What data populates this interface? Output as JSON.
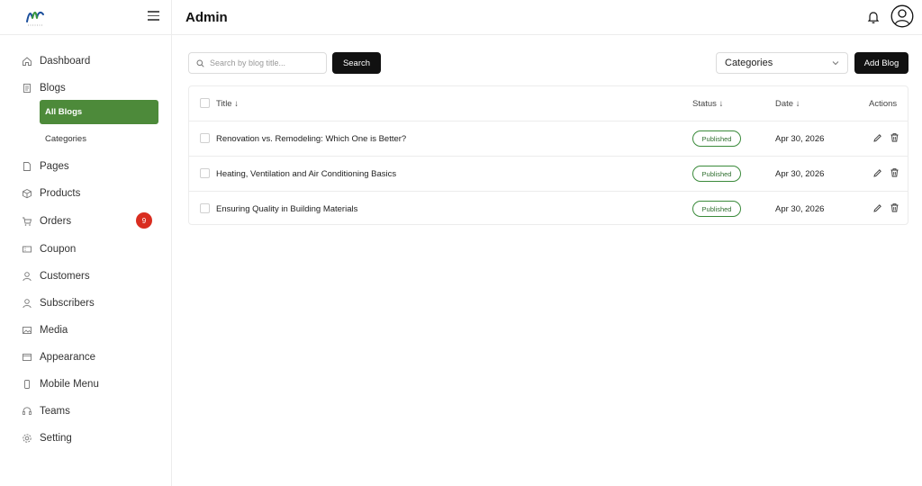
{
  "header": {
    "title": "Admin"
  },
  "sidebar": {
    "items": [
      {
        "label": "Dashboard",
        "icon": "home-icon"
      },
      {
        "label": "Blogs",
        "icon": "document-icon",
        "children": [
          {
            "label": "All Blogs",
            "active": true
          },
          {
            "label": "Categories"
          }
        ]
      },
      {
        "label": "Pages",
        "icon": "page-icon"
      },
      {
        "label": "Products",
        "icon": "box-icon"
      },
      {
        "label": "Orders",
        "icon": "cart-icon",
        "badge": "9"
      },
      {
        "label": "Coupon",
        "icon": "coupon-icon"
      },
      {
        "label": "Customers",
        "icon": "user-icon"
      },
      {
        "label": "Subscribers",
        "icon": "user-icon"
      },
      {
        "label": "Media",
        "icon": "media-icon"
      },
      {
        "label": "Appearance",
        "icon": "appearance-icon"
      },
      {
        "label": "Mobile Menu",
        "icon": "mobile-icon"
      },
      {
        "label": "Teams",
        "icon": "headset-icon"
      },
      {
        "label": "Setting",
        "icon": "gear-icon"
      }
    ]
  },
  "toolbar": {
    "search_placeholder": "Search by blog title...",
    "search_label": "Search",
    "category_select": "Categories",
    "add_label": "Add Blog"
  },
  "table": {
    "columns": {
      "title": "Title ↓",
      "status": "Status ↓",
      "date": "Date ↓",
      "actions": "Actions"
    },
    "rows": [
      {
        "title": "Renovation vs. Remodeling: Which One is Better?",
        "status": "Published",
        "date": "Apr 30, 2026"
      },
      {
        "title": "Heating, Ventilation and Air Conditioning Basics",
        "status": "Published",
        "date": "Apr 30, 2026"
      },
      {
        "title": "Ensuring Quality in Building Materials",
        "status": "Published",
        "date": "Apr 30, 2026"
      }
    ]
  },
  "colors": {
    "accent": "#4d8a3a",
    "badge": "#d92d20",
    "primary_button": "#111111",
    "published": "#3a8a3a"
  }
}
